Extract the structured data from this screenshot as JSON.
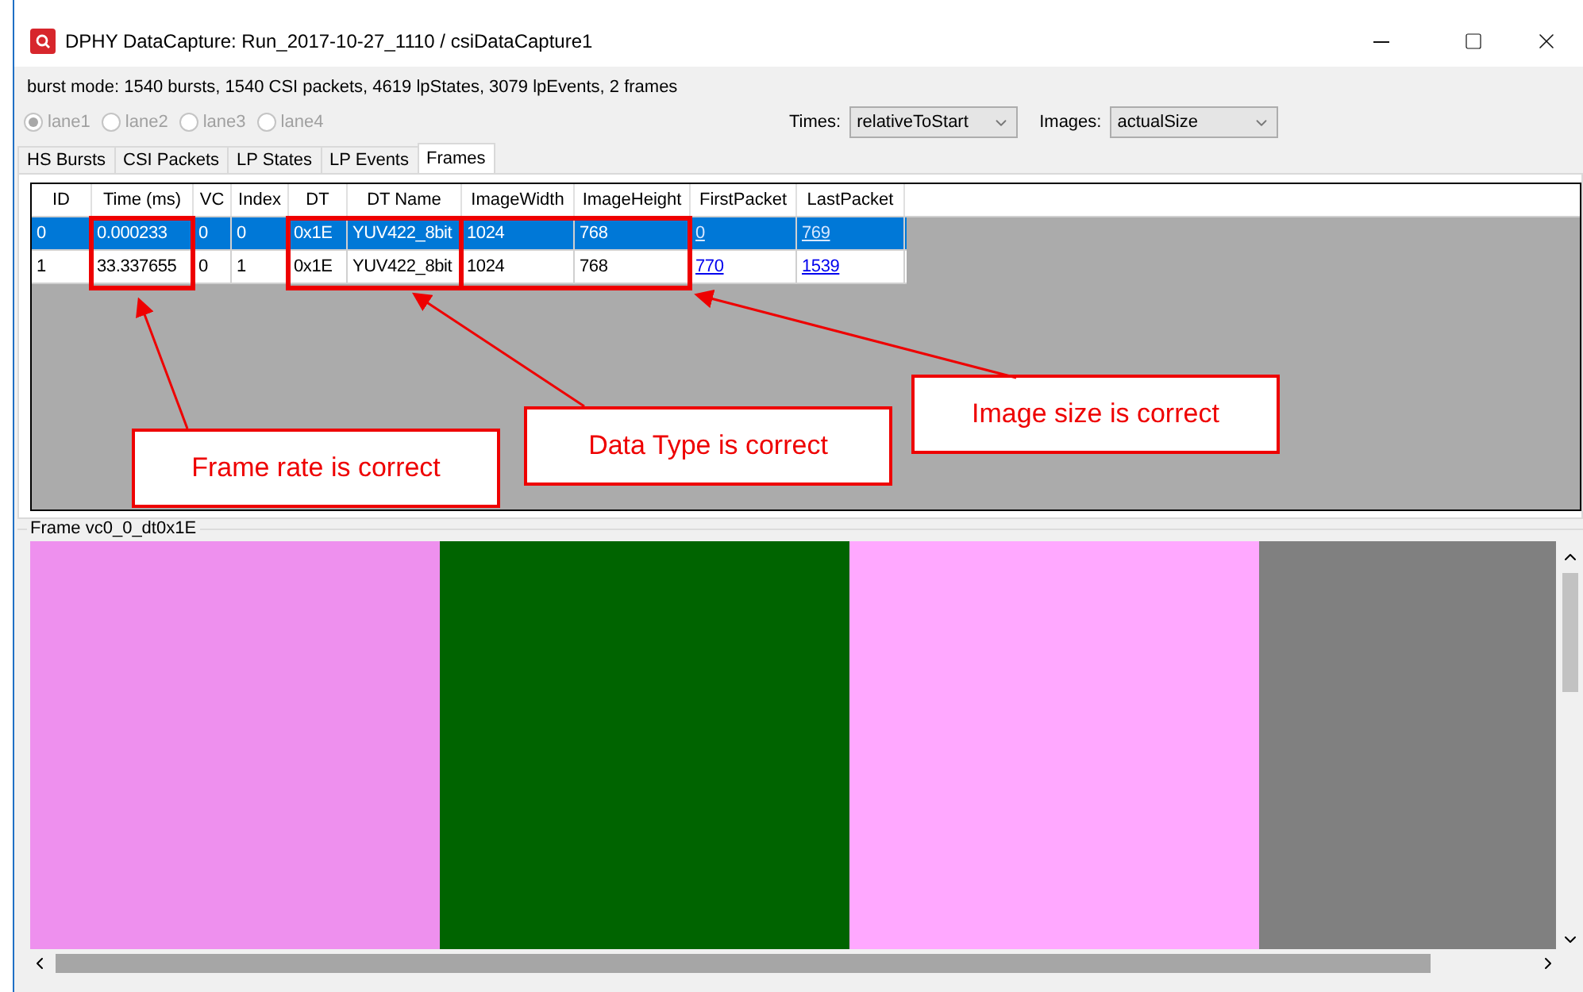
{
  "window": {
    "title": "DPHY DataCapture: Run_2017-10-27_1110 / csiDataCapture1"
  },
  "summary": "burst mode: 1540 bursts, 1540 CSI packets, 4619 lpStates, 3079 lpEvents, 2 frames",
  "lanes": [
    {
      "label": "lane1",
      "selected": true,
      "disabled": true
    },
    {
      "label": "lane2",
      "selected": false,
      "disabled": true
    },
    {
      "label": "lane3",
      "selected": false,
      "disabled": true
    },
    {
      "label": "lane4",
      "selected": false,
      "disabled": true
    }
  ],
  "times": {
    "label": "Times:",
    "value": "relativeToStart"
  },
  "images": {
    "label": "Images:",
    "value": "actualSize"
  },
  "tabs": [
    {
      "label": "HS Bursts",
      "selected": false
    },
    {
      "label": "CSI Packets",
      "selected": false
    },
    {
      "label": "LP States",
      "selected": false
    },
    {
      "label": "LP Events",
      "selected": false
    },
    {
      "label": "Frames",
      "selected": true
    }
  ],
  "table": {
    "columns": [
      {
        "label": "ID",
        "kind": "text"
      },
      {
        "label": "Time (ms)",
        "kind": "text"
      },
      {
        "label": "VC",
        "kind": "text"
      },
      {
        "label": "Index",
        "kind": "text"
      },
      {
        "label": "DT",
        "kind": "text"
      },
      {
        "label": "DT Name",
        "kind": "text"
      },
      {
        "label": "ImageWidth",
        "kind": "text"
      },
      {
        "label": "ImageHeight",
        "kind": "text"
      },
      {
        "label": "FirstPacket",
        "kind": "link"
      },
      {
        "label": "LastPacket",
        "kind": "link"
      }
    ],
    "rows": [
      {
        "selected": true,
        "cells": [
          "0",
          "0.000233",
          "0",
          "0",
          "0x1E",
          "YUV422_8bit",
          "1024",
          "768",
          "0",
          "769"
        ]
      },
      {
        "selected": false,
        "cells": [
          "1",
          "33.337655",
          "0",
          "1",
          "0x1E",
          "YUV422_8bit",
          "1024",
          "768",
          "770",
          "1539"
        ]
      }
    ]
  },
  "callouts": [
    {
      "text": "Frame rate is correct"
    },
    {
      "text": "Data Type is correct"
    },
    {
      "text": "Image size is correct"
    }
  ],
  "frame_panel": {
    "title": "Frame vc0_0_dt0x1E"
  }
}
